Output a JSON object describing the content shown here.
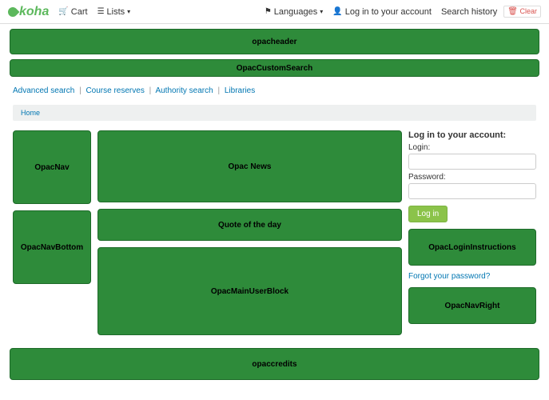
{
  "brand": "koha",
  "topnav": {
    "cart": "Cart",
    "lists": "Lists",
    "languages": "Languages",
    "login": "Log in to your account",
    "history": "Search history",
    "clear": "Clear"
  },
  "blocks": {
    "header": "opacheader",
    "customsearch": "OpacCustomSearch",
    "nav": "OpacNav",
    "navbottom": "OpacNavBottom",
    "news": "Opac News",
    "quote": "Quote of the day",
    "mainuser": "OpacMainUserBlock",
    "logininstr": "OpacLoginInstructions",
    "navright": "OpacNavRight",
    "credits": "opaccredits"
  },
  "searchlinks": {
    "advanced": "Advanced search",
    "course": "Course reserves",
    "authority": "Authority search",
    "libraries": "Libraries"
  },
  "breadcrumb": {
    "home": "Home"
  },
  "login": {
    "title": "Log in to your account:",
    "loginlabel": "Login:",
    "passwordlabel": "Password:",
    "button": "Log in",
    "forgot": "Forgot your password?"
  }
}
